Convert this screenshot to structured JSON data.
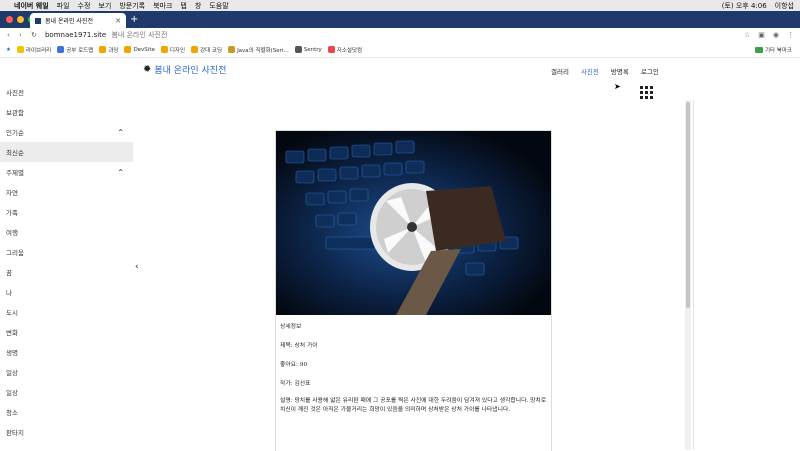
{
  "macbar": {
    "app": "네이버 웨일",
    "menu": [
      "파일",
      "수정",
      "보기",
      "방문기록",
      "북마크",
      "탭",
      "창",
      "도움말"
    ],
    "clock": "(토) 오후 4:06",
    "user": "이항섭"
  },
  "tab": {
    "title": "봄내 온라인 사진전"
  },
  "address": {
    "url": "bomnae1971.site",
    "title": "봄내 온라인 사진전"
  },
  "bookmarks": [
    {
      "label": "라이브러리",
      "color": "#f2c300"
    },
    {
      "label": "공부 로드맵",
      "color": "#3b73d6"
    },
    {
      "label": "과잉",
      "color": "#f0a500"
    },
    {
      "label": "DevSite",
      "color": "#f0a500"
    },
    {
      "label": "디자인",
      "color": "#f0a500"
    },
    {
      "label": "강대 코딩",
      "color": "#f0a500"
    },
    {
      "label": "Java의 직렬화(Seri...",
      "color": "#c79b22"
    },
    {
      "label": "Sentry",
      "color": "#555"
    },
    {
      "label": "자소설닷컴",
      "color": "#e44"
    }
  ],
  "bookmarks_other": "기타 북마크",
  "site": {
    "logo": "봄내 온라인 사진전",
    "nav": [
      "갤러리",
      "사진전",
      "방명록",
      "로그인"
    ],
    "nav_active_index": 1
  },
  "sidebar": [
    {
      "label": "사진전"
    },
    {
      "label": "보관함"
    },
    {
      "label": "인기순",
      "chevron": "up"
    },
    {
      "label": "최신순",
      "active": true
    },
    {
      "label": "주제별",
      "chevron": "up"
    },
    {
      "label": "자연"
    },
    {
      "label": "가족"
    },
    {
      "label": "여행"
    },
    {
      "label": "그리움"
    },
    {
      "label": "꿈"
    },
    {
      "label": "나"
    },
    {
      "label": "도시"
    },
    {
      "label": "변화"
    },
    {
      "label": "생명"
    },
    {
      "label": "일상"
    },
    {
      "label": "일상"
    },
    {
      "label": "청소"
    },
    {
      "label": "판타지"
    }
  ],
  "post": {
    "caption": "상세정보",
    "title_line": "제목: 상처 가이",
    "likes": "좋아요: 90",
    "author": "작가: 김선표",
    "description": "설명: 망치를 사용해 얇은 유리판 패에 그 공포를 찍은 사진에 대한 두려움이 담겨져 있다고 생각합니다. 망치로 치신이 깨진 것은 아직은 가물거리는 희망이 있음을 의미하며 상처받은 상처 가이를 나타냅니다."
  },
  "colors": {
    "accent": "#2a66c9",
    "tabbar": "#1f3a6b"
  }
}
